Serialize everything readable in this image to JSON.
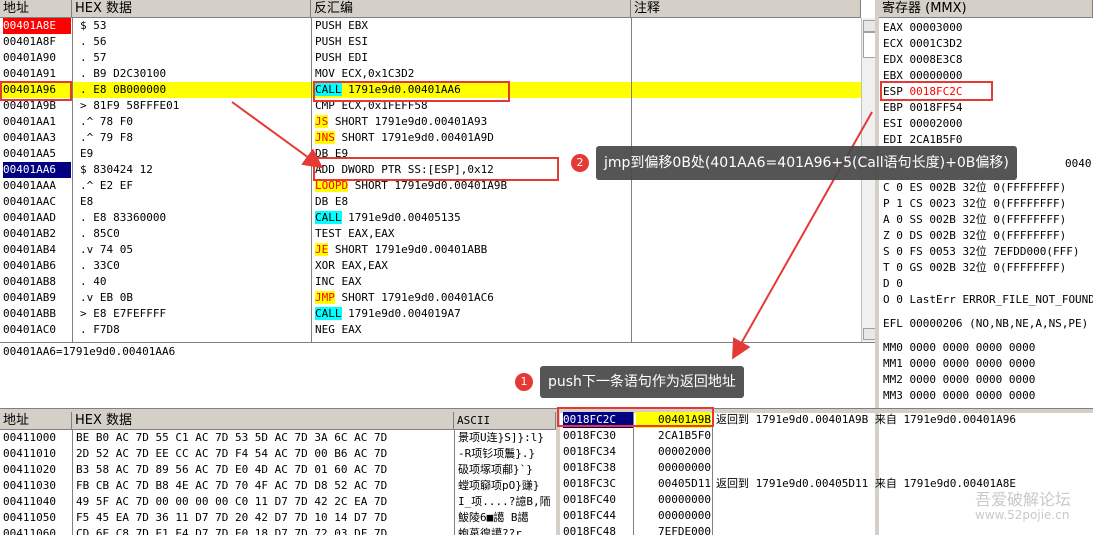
{
  "headers": {
    "addr": "地址",
    "hex": "HEX 数据",
    "disasm": "反汇编",
    "comment": "注释",
    "regs": "寄存器 (MMX)",
    "dump_addr": "地址",
    "dump_hex": "HEX 数据",
    "dump_ascii": "ASCII"
  },
  "disasm_rows": [
    {
      "addr": "00401A8E",
      "hex": "$  53",
      "asm": "PUSH EBX"
    },
    {
      "addr": "00401A8F",
      "hex": ".  56",
      "asm": "PUSH ESI"
    },
    {
      "addr": "00401A90",
      "hex": ".  57",
      "asm": "PUSH EDI"
    },
    {
      "addr": "00401A91",
      "hex": ".  B9 D2C30100",
      "asm": "MOV ECX,0x1C3D2"
    },
    {
      "addr": "00401A96",
      "hex": ".  E8 0B000000",
      "kw": "CALL",
      "rest": " 1791e9d0.00401AA6"
    },
    {
      "addr": "00401A9B",
      "hex": ">  81F9 58FFFE01",
      "asm": "CMP ECX,0x1FEFF58"
    },
    {
      "addr": "00401AA1",
      "hex": ".^ 78 F0",
      "kw": "JS",
      "rest": " SHORT 1791e9d0.00401A93"
    },
    {
      "addr": "00401AA3",
      "hex": ".^ 79 F8",
      "kw": "JNS",
      "rest": " SHORT 1791e9d0.00401A9D"
    },
    {
      "addr": "00401AA5",
      "hex": "   E9",
      "asm": "DB E9"
    },
    {
      "addr": "00401AA6",
      "hex": "$  830424 12",
      "asm": "ADD DWORD PTR SS:[ESP],0x12"
    },
    {
      "addr": "00401AAA",
      "hex": ".^ E2 EF",
      "kw": "LOOPD",
      "rest": " SHORT 1791e9d0.00401A9B"
    },
    {
      "addr": "00401AAC",
      "hex": "   E8",
      "asm": "DB E8"
    },
    {
      "addr": "00401AAD",
      "hex": ".  E8 83360000",
      "kw": "CALL",
      "rest": " 1791e9d0.00405135"
    },
    {
      "addr": "00401AB2",
      "hex": ".  85C0",
      "asm": "TEST EAX,EAX"
    },
    {
      "addr": "00401AB4",
      "hex": ".v 74 05",
      "kw": "JE",
      "rest": " SHORT 1791e9d0.00401ABB"
    },
    {
      "addr": "00401AB6",
      "hex": ".  33C0",
      "asm": "XOR EAX,EAX"
    },
    {
      "addr": "00401AB8",
      "hex": ".  40",
      "asm": "INC EAX"
    },
    {
      "addr": "00401AB9",
      "hex": ".v EB 0B",
      "kw": "JMP",
      "rest": " SHORT 1791e9d0.00401AC6"
    },
    {
      "addr": "00401ABB",
      "hex": ">  E8 E7FEFFFF",
      "kw": "CALL",
      "rest": " 1791e9d0.004019A7"
    },
    {
      "addr": "00401AC0",
      "hex": ".  F7D8",
      "asm": "NEG EAX"
    }
  ],
  "info_line": "00401AA6=1791e9d0.00401AA6",
  "registers": [
    {
      "name": "EAX",
      "val": "00003000"
    },
    {
      "name": "ECX",
      "val": "0001C3D2"
    },
    {
      "name": "EDX",
      "val": "0008E3C8"
    },
    {
      "name": "EBX",
      "val": "00000000"
    },
    {
      "name": "ESP",
      "val": "0018FC2C"
    },
    {
      "name": "EBP",
      "val": "0018FF54"
    },
    {
      "name": "ESI",
      "val": "00002000"
    },
    {
      "name": "EDI",
      "val": "2CA1B5F0"
    }
  ],
  "eip_partial": "0040",
  "segs": [
    {
      "f": "C 0",
      "s": "ES 002B 32位 0(FFFFFFFF)"
    },
    {
      "f": "P 1",
      "s": "CS 0023 32位 0(FFFFFFFF)"
    },
    {
      "f": "A 0",
      "s": "SS 002B 32位 0(FFFFFFFF)"
    },
    {
      "f": "Z 0",
      "s": "DS 002B 32位 0(FFFFFFFF)"
    },
    {
      "f": "S 0",
      "s": "FS 0053 32位 7EFDD000(FFF)"
    },
    {
      "f": "T 0",
      "s": "GS 002B 32位 0(FFFFFFFF)"
    },
    {
      "f": "D 0",
      "s": ""
    },
    {
      "f": "O 0",
      "s": "LastErr ERROR_FILE_NOT_FOUND"
    }
  ],
  "efl": "EFL 00000206 (NO,NB,NE,A,NS,PE)",
  "mmx": [
    "MM0 0000 0000 0000 0000",
    "MM1 0000 0000 0000 0000",
    "MM2 0000 0000 0000 0000",
    "MM3 0000 0000 0000 0000"
  ],
  "dump_rows": [
    {
      "addr": "00411000",
      "hex": "BE B0 AC 7D 55 C1 AC 7D 53 5D AC 7D 3A 6C AC 7D",
      "ascii": "景项U连}S]}:l}"
    },
    {
      "addr": "00411010",
      "hex": "2D 52 AC 7D EE CC AC 7D F4 54 AC 7D 00 B6 AC 7D",
      "ascii": "-R项钐项鬞}.}"
    },
    {
      "addr": "00411020",
      "hex": "B3 58 AC 7D 89 56 AC 7D E0 4D AC 7D 01 60 AC 7D",
      "ascii": "砐项塚项郙}`}"
    },
    {
      "addr": "00411030",
      "hex": "FB CB AC 7D B8 4E AC 7D 70 4F AC 7D D8 52 AC 7D",
      "ascii": "螳项窷项pO}豏}"
    },
    {
      "addr": "00411040",
      "hex": "49 5F AC 7D 00 00 00 00 C0 11 D7 7D 42 2C EA 7D",
      "ascii": "I_项....?譩B,陑"
    },
    {
      "addr": "00411050",
      "hex": "F5 45 EA 7D 36 11 D7 7D 20 42 D7 7D 10 14 D7 7D",
      "ascii": "鮁陵6■譪 B譪"
    },
    {
      "addr": "00411060",
      "hex": "CD 6E C8 7D E1 E4 D7 7D E0 18 D7 7D 72 03 DF 7D",
      "ascii": "蚫葲徨譪??r"
    }
  ],
  "stack_rows": [
    {
      "addr": "0018FC2C",
      "val": "00401A9B",
      "cmt": "返回到 1791e9d0.00401A9B 来自 1791e9d0.00401A96"
    },
    {
      "addr": "0018FC30",
      "val": "2CA1B5F0",
      "cmt": ""
    },
    {
      "addr": "0018FC34",
      "val": "00002000",
      "cmt": ""
    },
    {
      "addr": "0018FC38",
      "val": "00000000",
      "cmt": ""
    },
    {
      "addr": "0018FC3C",
      "val": "00405D11",
      "cmt": "返回到 1791e9d0.00405D11 来自 1791e9d0.00401A8E"
    },
    {
      "addr": "0018FC40",
      "val": "00000000",
      "cmt": ""
    },
    {
      "addr": "0018FC44",
      "val": "00000000",
      "cmt": ""
    },
    {
      "addr": "0018FC48",
      "val": "7EFDE000",
      "cmt": ""
    }
  ],
  "annotations": {
    "n1": "1",
    "t1": "push下一条语句作为返回地址",
    "n2": "2",
    "t2": "jmp到偏移0B处(401AA6=401A96+5(Call语句长度)+0B偏移)"
  },
  "watermark": {
    "cn": "吾爱破解论坛",
    "url": "www.52pojie.cn"
  },
  "colors": {
    "redbox": "#e53935",
    "highlight": "#ffff00",
    "cyan": "#00ffff",
    "selred": "#ff0000",
    "selblue": "#000080"
  }
}
